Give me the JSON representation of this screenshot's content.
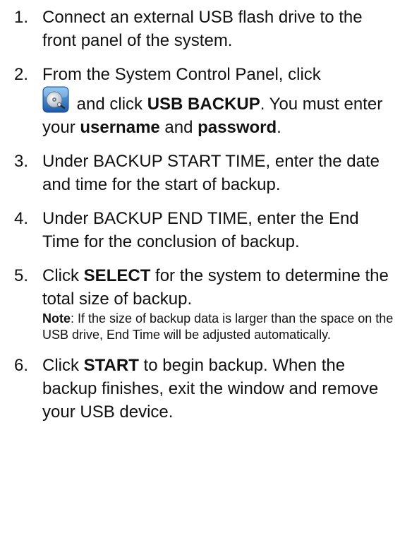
{
  "steps": [
    {
      "num": "1.",
      "text": "Connect an external USB flash drive to the front panel of the system."
    },
    {
      "num": "2.",
      "prefix": "From the System Control Panel, click",
      "icon": "backup-disk-icon",
      "mid1": " and click ",
      "bold1": "USB BACKUP",
      "mid2": ". You must enter your ",
      "bold2": "username",
      "mid3": " and ",
      "bold3": "password",
      "end": "."
    },
    {
      "num": "3.",
      "text": "Under BACKUP START TIME, enter the date and time for the start of backup."
    },
    {
      "num": "4.",
      "text": "Under BACKUP END TIME, enter the End Time for the conclusion of backup."
    },
    {
      "num": "5.",
      "pre": "Click ",
      "bold": "SELECT",
      "post": " for the system to determine the total size of backup.",
      "note_label": "Note",
      "note_text": ": If the size of backup data is larger than the space on the USB drive, End Time will be adjusted automatically."
    },
    {
      "num": "6.",
      "pre": "Click ",
      "bold": "START",
      "post": " to begin backup. When the backup finishes, exit the window and remove your USB device."
    }
  ],
  "colors": {
    "text": "#111111",
    "icon_bg_top": "#5aa6e6",
    "icon_bg_bottom": "#1f5fae"
  }
}
